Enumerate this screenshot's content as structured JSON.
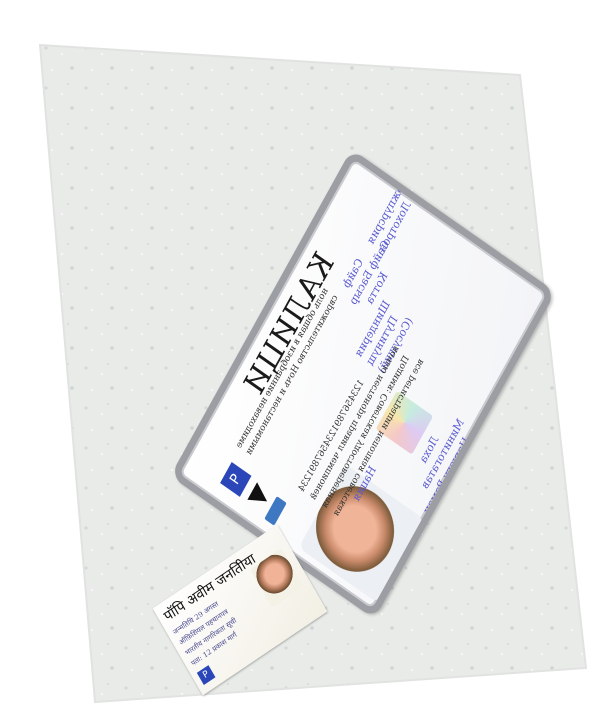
{
  "scene": {
    "background_color": "#ffffff",
    "granite_color": "#e6e8e6"
  },
  "main_card": {
    "title": "КАЛИЦИ",
    "fields": [
      {
        "label": "Сайф"
      },
      {
        "label": "Сайф Басыр"
      },
      {
        "label": "Котта"
      },
      {
        "label": "Кожпурсрия"
      },
      {
        "label": "Лохотрон"
      },
      {
        "label": "Шиндерия"
      },
      {
        "label": "Путинущ"
      },
      {
        "label": "(Сосущий)"
      },
      {
        "label": "Лоха"
      },
      {
        "label": "Минитогатав"
      },
      {
        "label": "Царюгу Раман"
      },
      {
        "label": "Нация"
      }
    ],
    "lines": [
      "ноль общая в изобранние неваходиме",
      "сврожительство Ночь и нестаномыми",
      "1234567891234567891234",
      "ночью нестанорь правил чемпионей",
      "Подимя: Советская удостоверенная",
      "все регистрации неполная советская"
    ]
  },
  "mini_card": {
    "title": "पॉपि अवीम जनतीिया",
    "lines": [
      "जन्मतिथि 29 अगस्त",
      "ऑफ़िशियल पहचानपत्र",
      "भारतीय नागरिकता सूची",
      "पता: 12 प्रकाश मार्ग"
    ]
  }
}
